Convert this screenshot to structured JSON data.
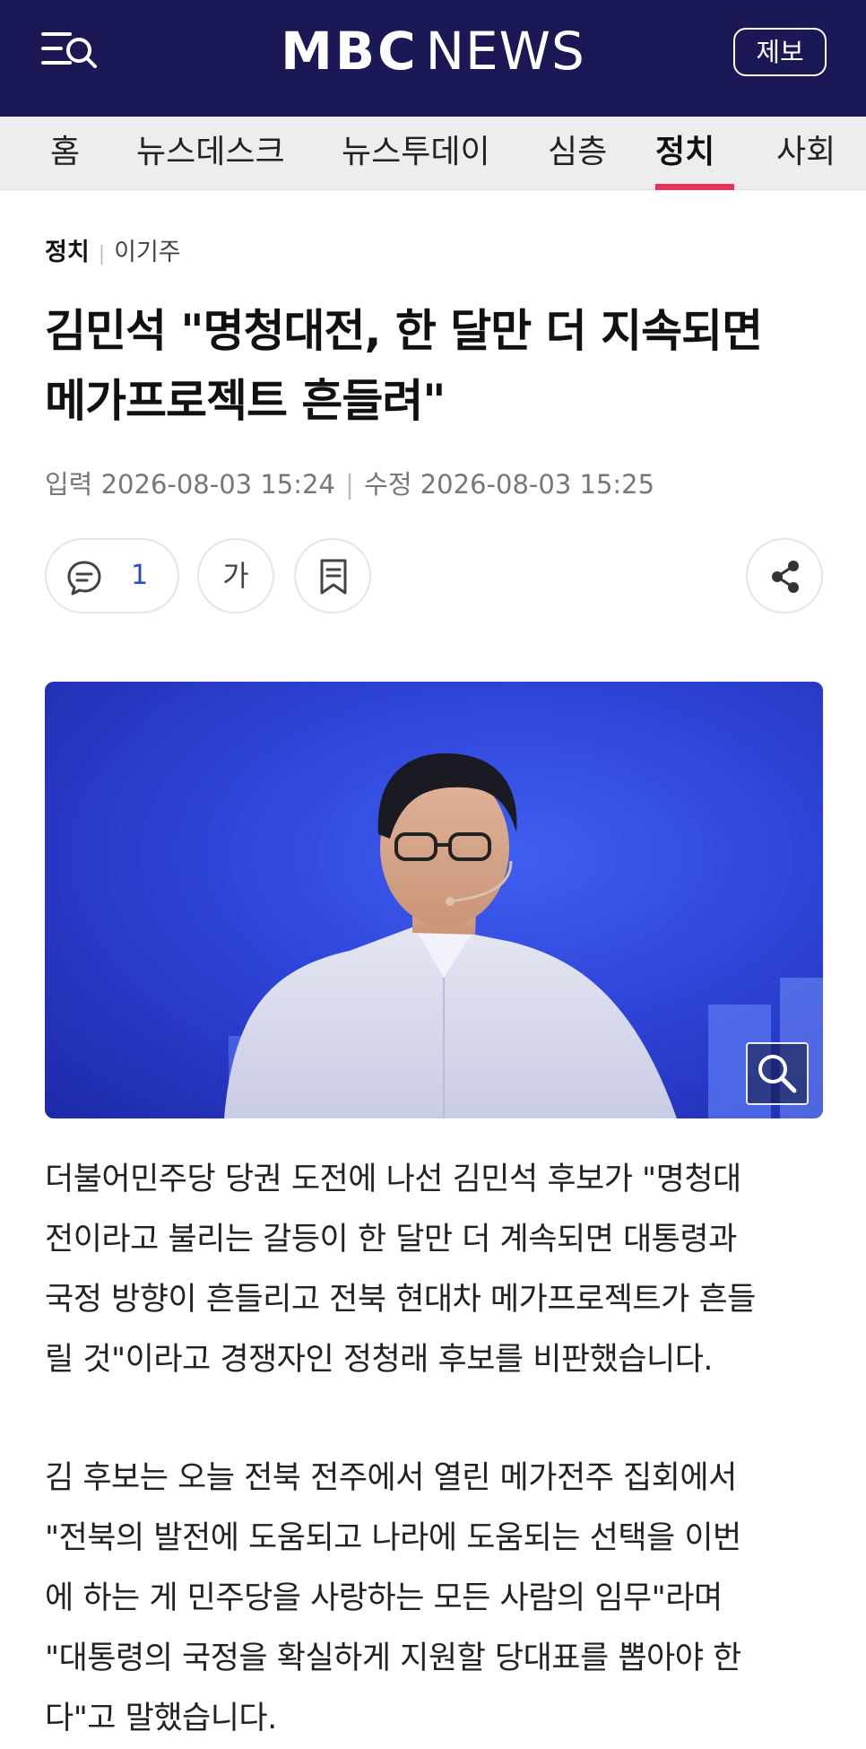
{
  "header": {
    "logo_mbc": "MBC",
    "logo_news": "NEWS",
    "report_label": "제보"
  },
  "nav": {
    "items": [
      "홈",
      "뉴스데스크",
      "뉴스투데이",
      "심층",
      "정치",
      "사회"
    ],
    "active": "정치"
  },
  "article": {
    "section": "정치",
    "author": "이기주",
    "headline_line1": "김민석 \"명청대전, 한 달만 더 지속되면",
    "headline_line2": "메가프로젝트 흔들려\"",
    "published_label": "입력",
    "published": "2026-08-03 15:24",
    "modified_label": "수정",
    "modified": "2026-08-03 15:25",
    "comment_count": "1",
    "font_size_glyph": "가",
    "paragraph1": [
      "더불어민주당 당권 도전에 나선 김민석 후보가 \"명청대",
      "전이라고 불리는 갈등이 한 달만 더 계속되면 대통령과",
      "국정 방향이 흔들리고 전북 현대차 메가프로젝트가 흔들",
      "릴 것\"이라고 경쟁자인 정청래 후보를 비판했습니다."
    ],
    "paragraph2": [
      "김 후보는 오늘 전북 전주에서 열린 메가전주 집회에서",
      "\"전북의 발전에 도움되고 나라에 도움되는 선택을 이번",
      "에 하는 게 민주당을 사랑하는 모든 사람의 임무\"라며",
      "\"대통령의 국정을 확실하게 지원할 당대표를 뽑아야 한",
      "다\"고 말했습니다."
    ]
  },
  "icons": {
    "menu": "menu-search-icon",
    "comment": "comment-icon",
    "bookmark": "bookmark-icon",
    "share": "share-icon",
    "zoom": "zoom-icon"
  },
  "colors": {
    "header_bg": "#1a1855",
    "nav_bg": "#ededed",
    "active_underline": "#e6335b",
    "comment_count": "#2a4bd1",
    "photo_bg": "#2e44d8"
  }
}
